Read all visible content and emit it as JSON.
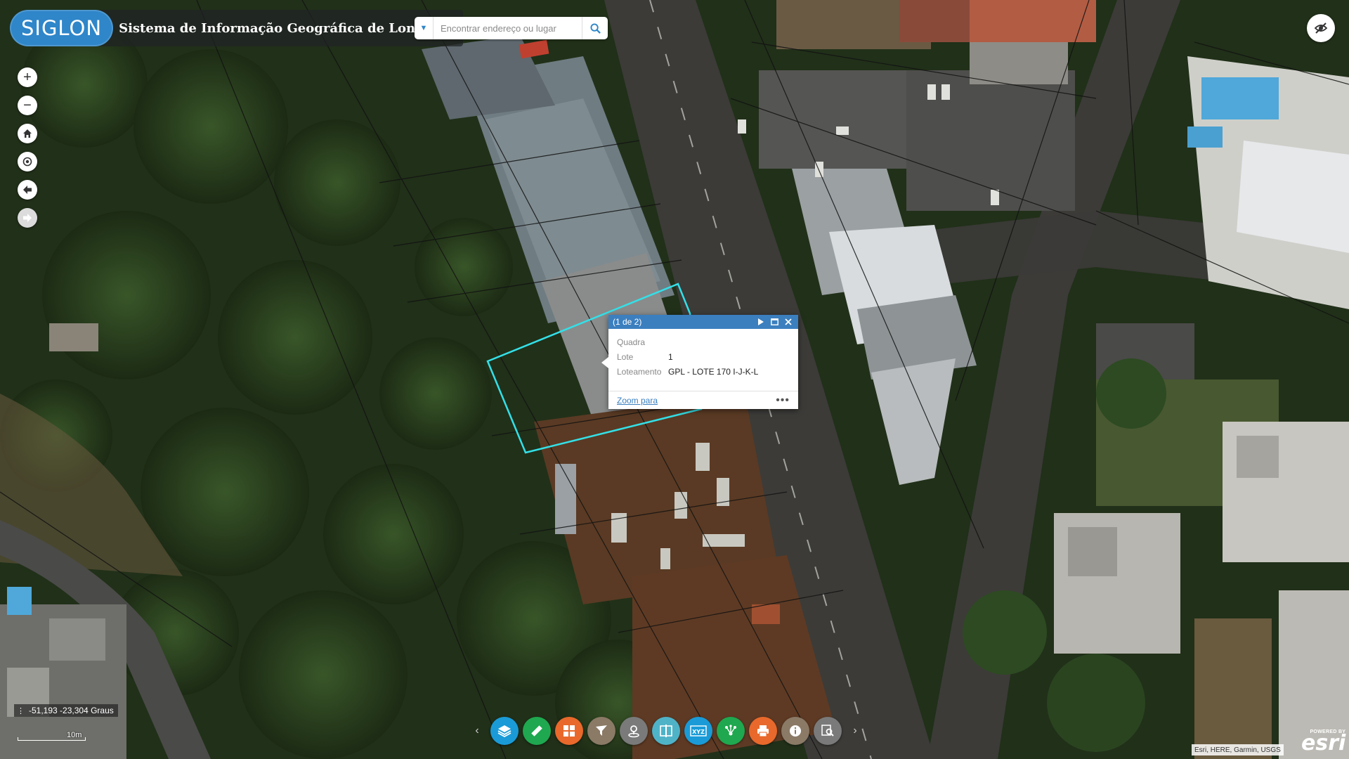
{
  "header": {
    "logo_text": "SIGLON",
    "title": "Sistema de Informação Geográfica de Londrina"
  },
  "search": {
    "placeholder": "Encontrar endereço ou lugar",
    "value": "",
    "dropdown_icon": "caret-down-icon",
    "search_icon": "search-icon"
  },
  "nav": {
    "zoom_in": "+",
    "zoom_out": "−",
    "icons": [
      "plus-icon",
      "minus-icon",
      "home-icon",
      "locate-icon",
      "back-arrow-icon",
      "forward-arrow-icon"
    ]
  },
  "popup": {
    "count": "(1 de 2)",
    "fields": [
      {
        "key": "Quadra",
        "value": ""
      },
      {
        "key": "Lote",
        "value": "1"
      },
      {
        "key": "Loteamento",
        "value": "GPL - LOTE 170 I-J-K-L"
      }
    ],
    "zoom_link": "Zoom para",
    "more": "•••"
  },
  "coords": {
    "text": "-51,193 -23,304 Graus"
  },
  "scale": {
    "label": "10m"
  },
  "toolbar": {
    "prev": "‹",
    "next": "›",
    "buttons": [
      {
        "name": "layers",
        "icon": "layers-icon",
        "color": "#1a9bd7"
      },
      {
        "name": "measure",
        "icon": "ruler-icon",
        "color": "#1fa84f"
      },
      {
        "name": "basemap-gallery",
        "icon": "grid-icon",
        "color": "#e8692b"
      },
      {
        "name": "filter",
        "icon": "funnel-icon",
        "color": "#8a7a66"
      },
      {
        "name": "streetview",
        "icon": "pin-icon",
        "color": "#7a7a7a"
      },
      {
        "name": "swipe",
        "icon": "swipe-icon",
        "color": "#4fb3c8"
      },
      {
        "name": "coordinates",
        "icon": "xyz-icon",
        "color": "#1a9bd7"
      },
      {
        "name": "share",
        "icon": "network-icon",
        "color": "#1fa84f"
      },
      {
        "name": "print",
        "icon": "print-icon",
        "color": "#e8692b"
      },
      {
        "name": "about",
        "icon": "info-icon",
        "color": "#8a7a66"
      },
      {
        "name": "search-query",
        "icon": "query-icon",
        "color": "#7a7a7a"
      }
    ]
  },
  "attribution": "Esri, HERE, Garmin, USGS",
  "esri": {
    "powered_by": "POWERED BY",
    "logo": "esri"
  },
  "colors": {
    "header_logo_bg": "#2f86c9",
    "popup_header": "#3b7fbf",
    "selection_outline": "#33e0e8"
  }
}
